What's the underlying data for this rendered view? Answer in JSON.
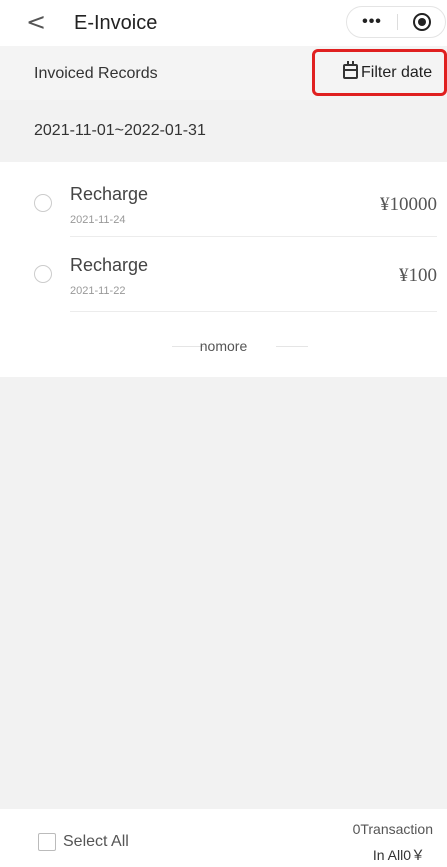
{
  "nav": {
    "back_glyph": "<",
    "title": "E-Invoice",
    "more_glyph": "•••"
  },
  "subheader": {
    "title": "Invoiced Records",
    "filter_label": "Filter date"
  },
  "date_range": "2021-11-01~2022-01-31",
  "records": [
    {
      "name": "Recharge",
      "date": "2021-11-24",
      "amount": "¥10000"
    },
    {
      "name": "Recharge",
      "date": "2021-11-22",
      "amount": "¥100"
    }
  ],
  "nomore": "nomore",
  "footer": {
    "select_all": "Select All",
    "transaction_count": "0Transaction",
    "total": "In All0￥"
  },
  "colors": {
    "highlight_border": "#e02020",
    "background_gray": "#f2f2f2"
  }
}
